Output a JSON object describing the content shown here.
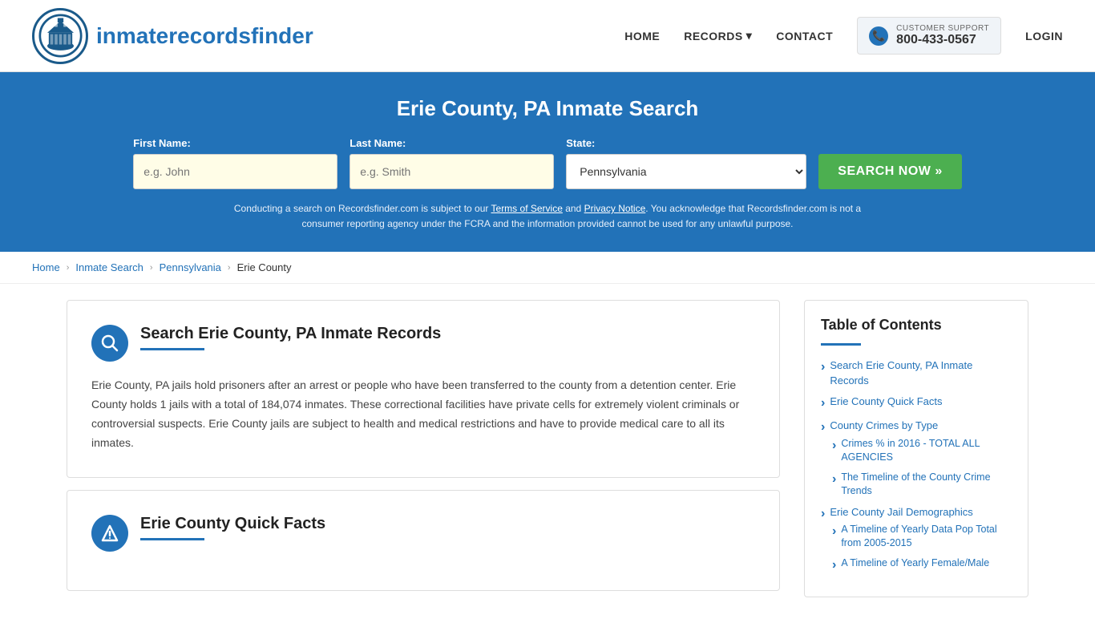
{
  "header": {
    "logo_text_regular": "inmaterecords",
    "logo_text_bold": "finder",
    "nav": {
      "home": "HOME",
      "records": "RECORDS",
      "contact": "CONTACT",
      "login": "LOGIN"
    },
    "support": {
      "label": "CUSTOMER SUPPORT",
      "phone": "800-433-0567"
    }
  },
  "hero": {
    "title": "Erie County, PA Inmate Search",
    "first_name_label": "First Name:",
    "first_name_placeholder": "e.g. John",
    "last_name_label": "Last Name:",
    "last_name_placeholder": "e.g. Smith",
    "state_label": "State:",
    "state_value": "Pennsylvania",
    "search_button": "SEARCH NOW »",
    "disclaimer": "Conducting a search on Recordsfinder.com is subject to our Terms of Service and Privacy Notice. You acknowledge that Recordsfinder.com is not a consumer reporting agency under the FCRA and the information provided cannot be used for any unlawful purpose.",
    "terms_link": "Terms of Service",
    "privacy_link": "Privacy Notice"
  },
  "breadcrumb": {
    "home": "Home",
    "inmate_search": "Inmate Search",
    "pennsylvania": "Pennsylvania",
    "current": "Erie County"
  },
  "main_section": {
    "title": "Search Erie County, PA Inmate Records",
    "body": "Erie County, PA jails hold prisoners after an arrest or people who have been transferred to the county from a detention center. Erie County holds 1 jails with a total of 184,074 inmates. These correctional facilities have private cells for extremely violent criminals or controversial suspects. Erie County jails are subject to health and medical restrictions and have to provide medical care to all its inmates."
  },
  "quick_facts_section": {
    "title": "Erie County Quick Facts"
  },
  "toc": {
    "title": "Table of Contents",
    "items": [
      {
        "label": "Search Erie County, PA Inmate Records"
      },
      {
        "label": "Erie County Quick Facts"
      },
      {
        "label": "County Crimes by Type"
      },
      {
        "sub_label": "Crimes % in 2016 - TOTAL ALL AGENCIES"
      },
      {
        "sub_label": "The Timeline of the County Crime Trends"
      },
      {
        "label": "Erie County Jail Demographics"
      },
      {
        "sub_label": "A Timeline of Yearly Data Pop Total from 2005-2015"
      },
      {
        "sub_label": "A Timeline of Yearly Female/Male"
      }
    ]
  }
}
